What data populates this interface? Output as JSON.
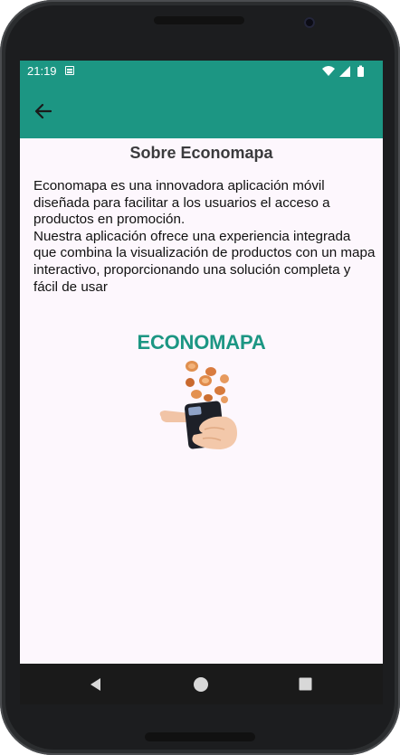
{
  "status_bar": {
    "time": "21:19",
    "icons": [
      "notes-icon",
      "wifi-icon",
      "signal-icon",
      "battery-icon"
    ]
  },
  "app_bar": {
    "back_icon": "arrow-left-icon"
  },
  "content": {
    "title": "Sobre Economapa",
    "description": "Economapa es una innovadora aplicación móvil diseñada para facilitar a los usuarios el acceso a productos en promoción.\nNuestra aplicación ofrece una experiencia integrada que combina la visualización de productos con un mapa interactivo, proporcionando una solución completa y fácil de usar",
    "brand": "ECONOMAPA",
    "illustration_icon": "hand-phone-coins-icon"
  },
  "nav_bar": {
    "icons": [
      "back-triangle-icon",
      "home-circle-icon",
      "recents-square-icon"
    ]
  },
  "colors": {
    "primary": "#1c9683",
    "background": "#fdf7fd",
    "title_text": "#3b3b3d"
  }
}
